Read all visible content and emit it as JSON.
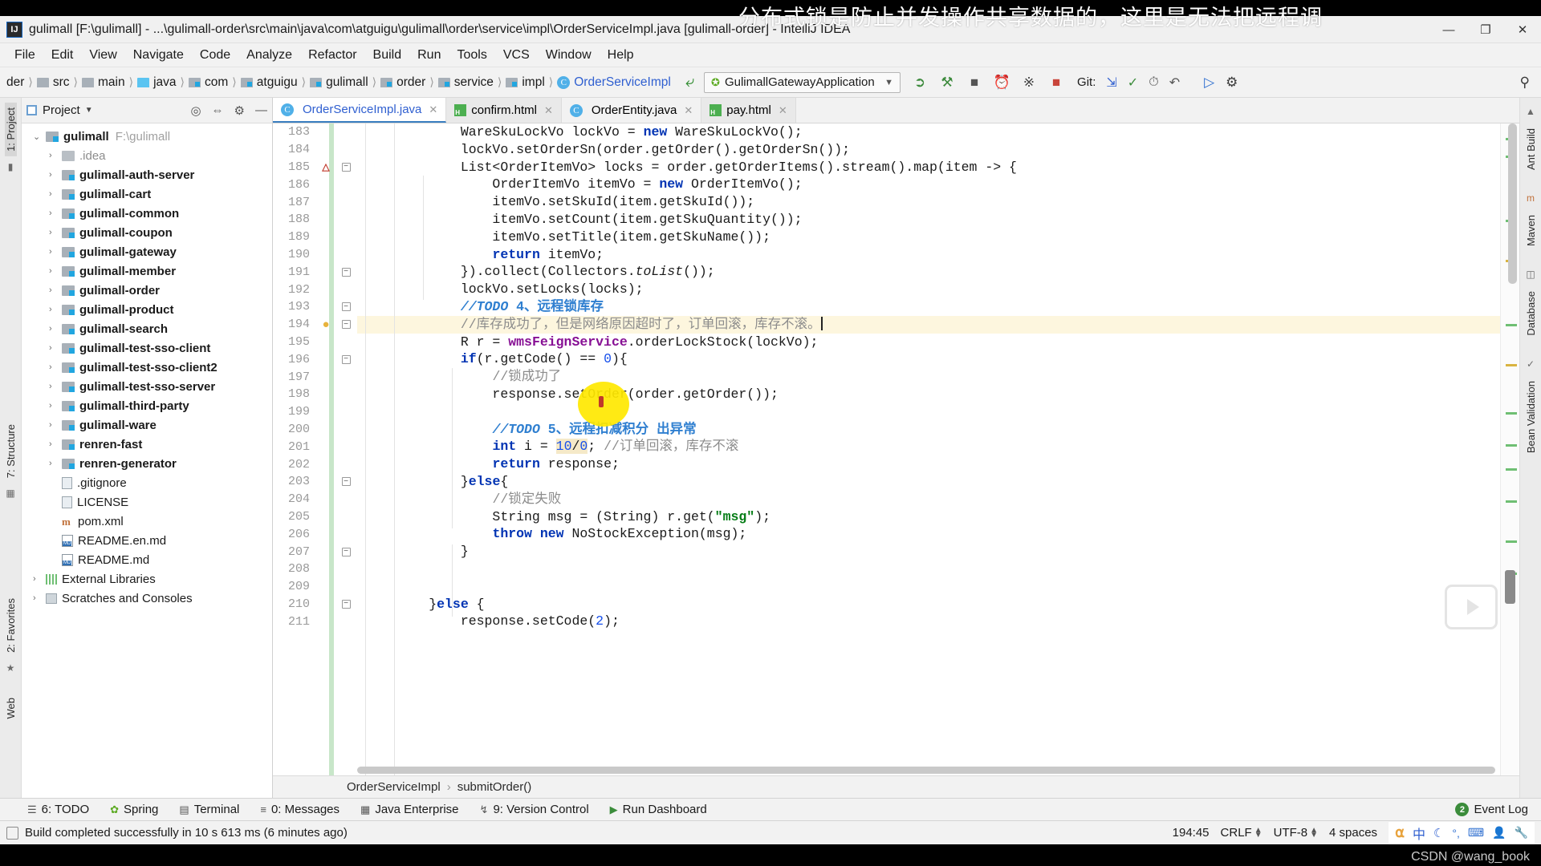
{
  "window": {
    "title": "gulimall [F:\\gulimall] - ...\\gulimall-order\\src\\main\\java\\com\\atguigu\\gulimall\\order\\service\\impl\\OrderServiceImpl.java [gulimall-order] - IntelliJ IDEA",
    "logo": "IJ",
    "minimize": "—",
    "maximize": "❐",
    "close": "✕"
  },
  "overlay": {
    "subtitle": "分布式锁是防止并发操作共享数据的，这里是无法把远程调",
    "watermark": "CSDN @wang_book"
  },
  "menu": [
    "File",
    "Edit",
    "View",
    "Navigate",
    "Code",
    "Analyze",
    "Refactor",
    "Build",
    "Run",
    "Tools",
    "VCS",
    "Window",
    "Help"
  ],
  "breadcrumb": [
    {
      "label": "der",
      "icon": "none"
    },
    {
      "label": "src",
      "icon": "folder-src-icon"
    },
    {
      "label": "main",
      "icon": "folder-main-icon"
    },
    {
      "label": "java",
      "icon": "folder-java-icon"
    },
    {
      "label": "com",
      "icon": "package-icon"
    },
    {
      "label": "atguigu",
      "icon": "package-icon"
    },
    {
      "label": "gulimall",
      "icon": "package-icon"
    },
    {
      "label": "order",
      "icon": "package-icon"
    },
    {
      "label": "service",
      "icon": "package-icon"
    },
    {
      "label": "impl",
      "icon": "package-icon"
    },
    {
      "label": "OrderServiceImpl",
      "icon": "java-class-icon"
    }
  ],
  "toolbar": {
    "run_config": "GulimallGatewayApplication",
    "git_label": "Git:",
    "icons": [
      "run-icon",
      "debug-icon",
      "run-with-coverage-icon",
      "profile-icon",
      "attach-debugger-icon",
      "stop-icon"
    ],
    "git_icons": [
      "update-project-icon",
      "commit-icon",
      "history-icon",
      "rollback-icon"
    ],
    "right_icons": [
      "settings-icon",
      "search-everywhere-icon"
    ]
  },
  "project_panel": {
    "title": "Project",
    "header_icons": [
      "locate-icon",
      "collapse-all-icon",
      "settings-icon",
      "hide-icon"
    ],
    "tree": [
      {
        "label": "gulimall",
        "path": "F:\\gulimall",
        "icon": "module-icon",
        "arrow": "⌄",
        "bold": true,
        "indent": 0
      },
      {
        "label": ".idea",
        "path": "",
        "icon": "folder-icon",
        "arrow": "›",
        "bold": false,
        "dim": true,
        "indent": 1
      },
      {
        "label": "gulimall-auth-server",
        "path": "",
        "icon": "module-icon",
        "arrow": "›",
        "bold": true,
        "indent": 1
      },
      {
        "label": "gulimall-cart",
        "path": "",
        "icon": "module-icon",
        "arrow": "›",
        "bold": true,
        "indent": 1
      },
      {
        "label": "gulimall-common",
        "path": "",
        "icon": "module-icon",
        "arrow": "›",
        "bold": true,
        "indent": 1
      },
      {
        "label": "gulimall-coupon",
        "path": "",
        "icon": "module-icon",
        "arrow": "›",
        "bold": true,
        "indent": 1
      },
      {
        "label": "gulimall-gateway",
        "path": "",
        "icon": "module-icon",
        "arrow": "›",
        "bold": true,
        "indent": 1
      },
      {
        "label": "gulimall-member",
        "path": "",
        "icon": "module-icon",
        "arrow": "›",
        "bold": true,
        "indent": 1
      },
      {
        "label": "gulimall-order",
        "path": "",
        "icon": "module-icon",
        "arrow": "›",
        "bold": true,
        "indent": 1
      },
      {
        "label": "gulimall-product",
        "path": "",
        "icon": "module-icon",
        "arrow": "›",
        "bold": true,
        "indent": 1
      },
      {
        "label": "gulimall-search",
        "path": "",
        "icon": "module-icon",
        "arrow": "›",
        "bold": true,
        "indent": 1
      },
      {
        "label": "gulimall-test-sso-client",
        "path": "",
        "icon": "module-icon",
        "arrow": "›",
        "bold": true,
        "indent": 1
      },
      {
        "label": "gulimall-test-sso-client2",
        "path": "",
        "icon": "module-icon",
        "arrow": "›",
        "bold": true,
        "indent": 1
      },
      {
        "label": "gulimall-test-sso-server",
        "path": "",
        "icon": "module-icon",
        "arrow": "›",
        "bold": true,
        "indent": 1
      },
      {
        "label": "gulimall-third-party",
        "path": "",
        "icon": "module-icon",
        "arrow": "›",
        "bold": true,
        "indent": 1
      },
      {
        "label": "gulimall-ware",
        "path": "",
        "icon": "module-icon",
        "arrow": "›",
        "bold": true,
        "indent": 1
      },
      {
        "label": "renren-fast",
        "path": "",
        "icon": "module-icon",
        "arrow": "›",
        "bold": true,
        "indent": 1
      },
      {
        "label": "renren-generator",
        "path": "",
        "icon": "module-icon",
        "arrow": "›",
        "bold": true,
        "indent": 1
      },
      {
        "label": ".gitignore",
        "path": "",
        "icon": "file-icon",
        "arrow": "",
        "bold": false,
        "indent": 1
      },
      {
        "label": "LICENSE",
        "path": "",
        "icon": "file-icon",
        "arrow": "",
        "bold": false,
        "indent": 1
      },
      {
        "label": "pom.xml",
        "path": "",
        "icon": "maven-icon",
        "arrow": "",
        "bold": false,
        "indent": 1
      },
      {
        "label": "README.en.md",
        "path": "",
        "icon": "markdown-icon",
        "arrow": "",
        "bold": false,
        "indent": 1
      },
      {
        "label": "README.md",
        "path": "",
        "icon": "markdown-icon",
        "arrow": "",
        "bold": false,
        "indent": 1
      },
      {
        "label": "External Libraries",
        "path": "",
        "icon": "libraries-icon",
        "arrow": "›",
        "bold": false,
        "indent": 0
      },
      {
        "label": "Scratches and Consoles",
        "path": "",
        "icon": "scratches-icon",
        "arrow": "›",
        "bold": false,
        "indent": 0
      }
    ]
  },
  "left_rail": [
    {
      "label": "1: Project",
      "selected": true
    },
    {
      "label": "7: Structure",
      "selected": false
    },
    {
      "label": "2: Favorites",
      "selected": false
    },
    {
      "label": "Web",
      "selected": false
    }
  ],
  "right_rail": [
    {
      "label": "Ant Build"
    },
    {
      "label": "Maven"
    },
    {
      "label": "Database"
    },
    {
      "label": "Bean Validation"
    }
  ],
  "tabs": [
    {
      "label": "OrderServiceImpl.java",
      "icon": "java-class-icon",
      "active": true
    },
    {
      "label": "confirm.html",
      "icon": "html-file-icon",
      "active": false
    },
    {
      "label": "OrderEntity.java",
      "icon": "java-class-icon",
      "active": false
    },
    {
      "label": "pay.html",
      "icon": "html-file-icon",
      "active": false
    }
  ],
  "editor": {
    "first_line": 183,
    "lines": [
      {
        "n": 183,
        "fold": "",
        "marker": "",
        "highlight": false
      },
      {
        "n": 184,
        "fold": "",
        "marker": "",
        "highlight": false
      },
      {
        "n": 185,
        "fold": "minus",
        "marker": "inspection",
        "highlight": false
      },
      {
        "n": 186,
        "fold": "",
        "marker": "",
        "highlight": false
      },
      {
        "n": 187,
        "fold": "",
        "marker": "",
        "highlight": false
      },
      {
        "n": 188,
        "fold": "",
        "marker": "",
        "highlight": false
      },
      {
        "n": 189,
        "fold": "",
        "marker": "",
        "highlight": false
      },
      {
        "n": 190,
        "fold": "",
        "marker": "",
        "highlight": false
      },
      {
        "n": 191,
        "fold": "end",
        "marker": "",
        "highlight": false
      },
      {
        "n": 192,
        "fold": "",
        "marker": "",
        "highlight": false
      },
      {
        "n": 193,
        "fold": "end",
        "marker": "",
        "highlight": false
      },
      {
        "n": 194,
        "fold": "end",
        "marker": "bulb",
        "highlight": true
      },
      {
        "n": 195,
        "fold": "",
        "marker": "",
        "highlight": false
      },
      {
        "n": 196,
        "fold": "minus",
        "marker": "",
        "highlight": false
      },
      {
        "n": 197,
        "fold": "",
        "marker": "",
        "highlight": false
      },
      {
        "n": 198,
        "fold": "",
        "marker": "",
        "highlight": false
      },
      {
        "n": 199,
        "fold": "",
        "marker": "",
        "highlight": false
      },
      {
        "n": 200,
        "fold": "",
        "marker": "",
        "highlight": false
      },
      {
        "n": 201,
        "fold": "",
        "marker": "",
        "highlight": false
      },
      {
        "n": 202,
        "fold": "",
        "marker": "",
        "highlight": false
      },
      {
        "n": 203,
        "fold": "minus",
        "marker": "",
        "highlight": false
      },
      {
        "n": 204,
        "fold": "",
        "marker": "",
        "highlight": false
      },
      {
        "n": 205,
        "fold": "",
        "marker": "",
        "highlight": false
      },
      {
        "n": 206,
        "fold": "",
        "marker": "",
        "highlight": false
      },
      {
        "n": 207,
        "fold": "end",
        "marker": "",
        "highlight": false
      },
      {
        "n": 208,
        "fold": "",
        "marker": "",
        "highlight": false
      },
      {
        "n": 209,
        "fold": "",
        "marker": "",
        "highlight": false
      },
      {
        "n": 210,
        "fold": "minus",
        "marker": "",
        "highlight": false
      },
      {
        "n": 211,
        "fold": "",
        "marker": "",
        "highlight": false
      }
    ],
    "code_text": [
      "            WareSkuLockVo lockVo = new WareSkuLockVo();",
      "            lockVo.setOrderSn(order.getOrder().getOrderSn());",
      "            List<OrderItemVo> locks = order.getOrderItems().stream().map(item -> {",
      "                OrderItemVo itemVo = new OrderItemVo();",
      "                itemVo.setSkuId(item.getSkuId());",
      "                itemVo.setCount(item.getSkuQuantity());",
      "                itemVo.setTitle(item.getSkuName());",
      "                return itemVo;",
      "            }).collect(Collectors.toList());",
      "            lockVo.setLocks(locks);",
      "            //TODO 4、远程锁库存",
      "            //库存成功了，但是网络原因超时了，订单回滚，库存不滚。",
      "            R r = wmsFeignService.orderLockStock(lockVo);",
      "            if(r.getCode() == 0){",
      "                //锁成功了",
      "                response.setOrder(order.getOrder());",
      "",
      "                //TODO 5、远程扣减积分 出异常",
      "                int i = 10/0; //订单回滚，库存不滚",
      "                return response;",
      "            }else{",
      "                //锁定失败",
      "                String msg = (String) r.get(\"msg\");",
      "                throw new NoStockException(msg);",
      "            }",
      "",
      "",
      "        }else {",
      "            response.setCode(2);"
    ],
    "breadcrumb": [
      "OrderServiceImpl",
      "submitOrder()"
    ],
    "breadcrumb_sep": "›"
  },
  "bottom_toolwindows": [
    {
      "label": "6: TODO",
      "icon": "todo-icon",
      "mnemonic": "6"
    },
    {
      "label": "Spring",
      "icon": "spring-icon",
      "mnemonic": ""
    },
    {
      "label": "Terminal",
      "icon": "terminal-icon",
      "mnemonic": ""
    },
    {
      "label": "0: Messages",
      "icon": "messages-icon",
      "mnemonic": "0"
    },
    {
      "label": "Java Enterprise",
      "icon": "java-enterprise-icon",
      "mnemonic": ""
    },
    {
      "label": "9: Version Control",
      "icon": "version-control-icon",
      "mnemonic": "9"
    },
    {
      "label": "Run Dashboard",
      "icon": "run-dashboard-icon",
      "mnemonic": ""
    }
  ],
  "event_log": {
    "label": "Event Log",
    "count": "2"
  },
  "statusbar": {
    "message": "Build completed successfully in 10 s 613 ms (6 minutes ago)",
    "caret_position": "194:45",
    "line_separator": "CRLF",
    "encoding": "UTF-8",
    "indent": "4 spaces",
    "tray_icons": [
      "ukey-icon",
      "ime-chinese-icon",
      "moon-icon",
      "degree-icon",
      "keyboard-icon",
      "user-icon",
      "wrench-icon"
    ],
    "ime_label": "中"
  },
  "colors": {
    "accent": "#3a7ec0",
    "keyword": "#0033b3",
    "string": "#067d17",
    "comment": "#8c8c8c",
    "todo": "#2f7fd0",
    "field": "#871094",
    "number": "#1750eb",
    "highlight_line": "#fdf6de",
    "cursor_blob": "#ffe800",
    "green_modified": "#c8e6c9"
  }
}
